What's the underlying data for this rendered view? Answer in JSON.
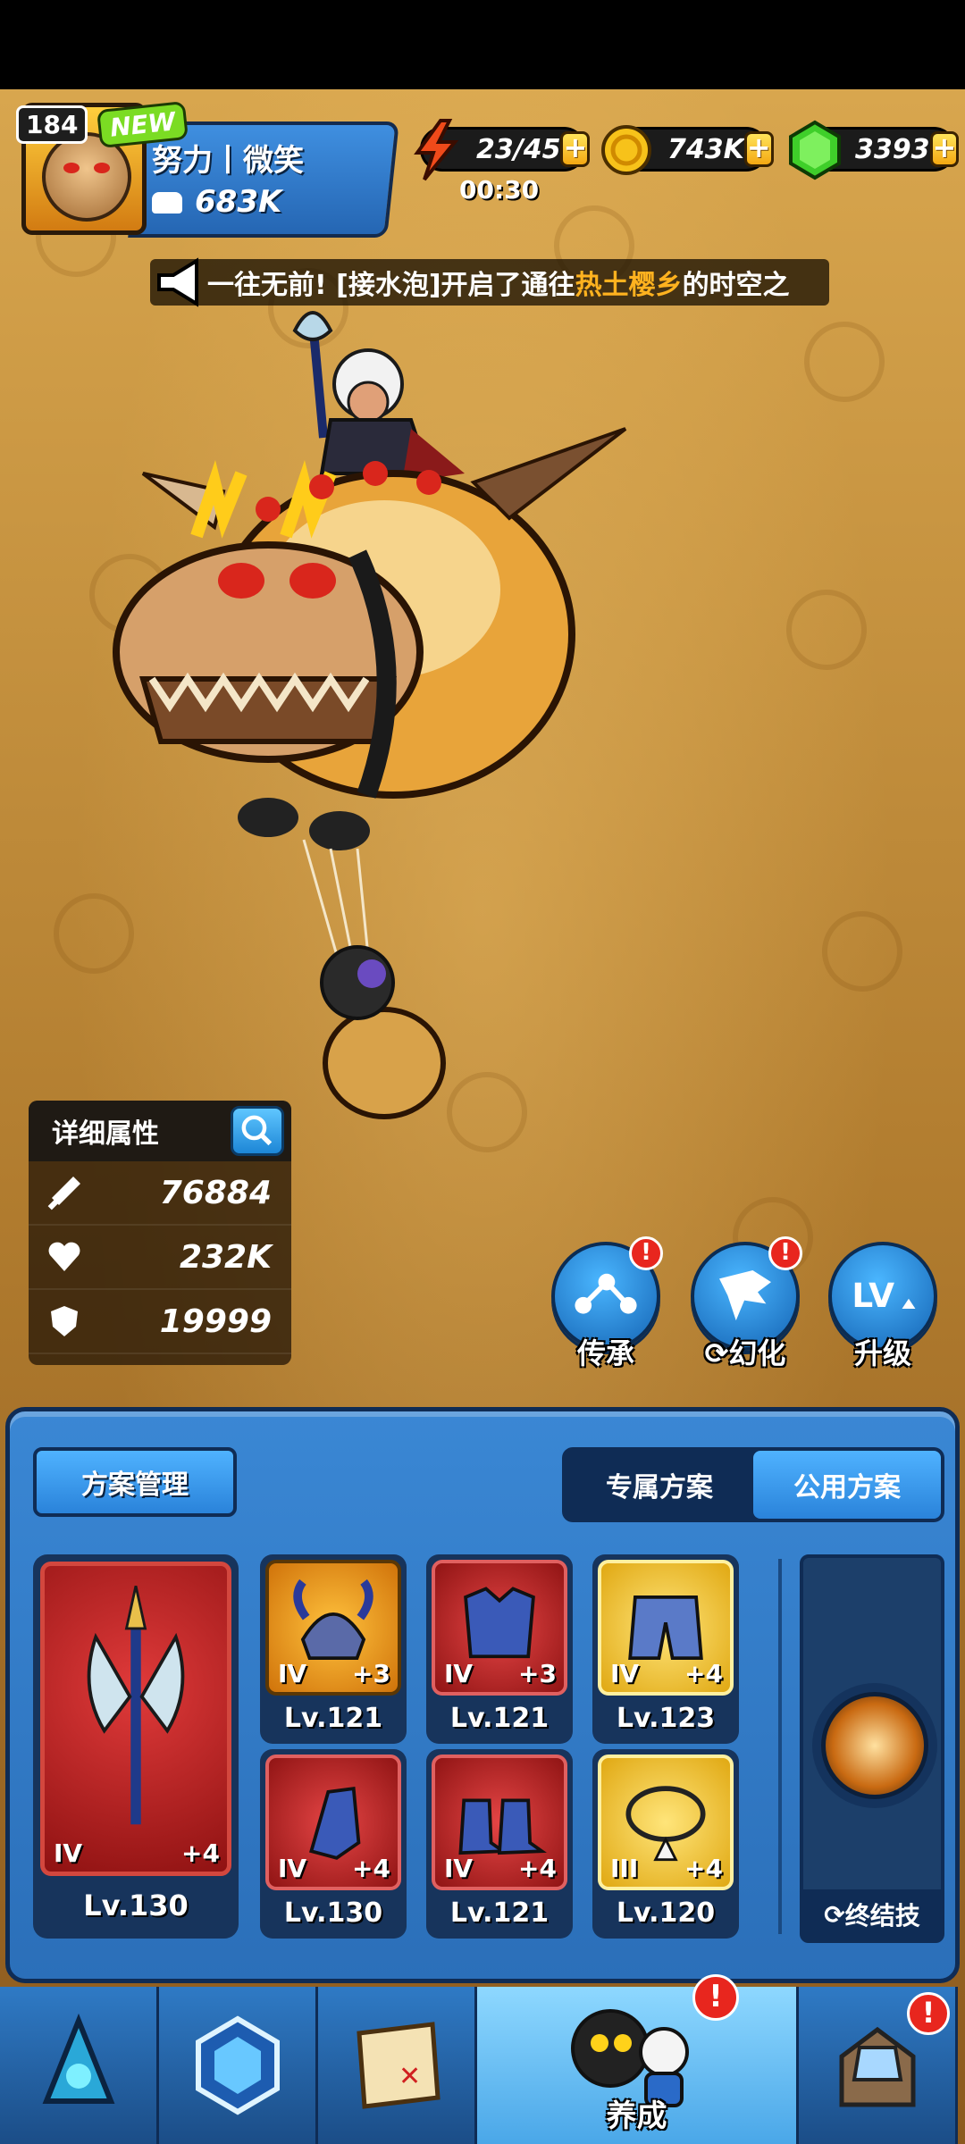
{
  "player": {
    "level": "184",
    "new_badge": "NEW",
    "name": "努力丨微笑",
    "power": "683K"
  },
  "resources": {
    "stamina": "23/45",
    "stamina_timer": "00:30",
    "gold": "743K",
    "gems": "3393",
    "plus": "+"
  },
  "announcement": {
    "prefix": "一往无前! [接水泡]开启了通往",
    "highlight": "热土樱乡",
    "suffix": "的时空之"
  },
  "stats": {
    "title": "详细属性",
    "attack": "76884",
    "hp": "232K",
    "defense": "19999"
  },
  "actions": [
    {
      "label": "传承",
      "badge": "!"
    },
    {
      "label": "幻化",
      "badge": "!"
    },
    {
      "label": "升级"
    }
  ],
  "equipment": {
    "plan_mgmt": "方案管理",
    "tabs": [
      "专属方案",
      "公用方案"
    ],
    "active_tab": "公用方案",
    "weapon": {
      "tier": "IV",
      "plus": "+4",
      "level": "Lv.130"
    },
    "slots": [
      {
        "tier": "IV",
        "plus": "+3",
        "level": "Lv.121",
        "rarity": "orange"
      },
      {
        "tier": "IV",
        "plus": "+3",
        "level": "Lv.121",
        "rarity": "red"
      },
      {
        "tier": "IV",
        "plus": "+4",
        "level": "Lv.123",
        "rarity": "gold"
      },
      {
        "tier": "IV",
        "plus": "+4",
        "level": "Lv.130",
        "rarity": "red"
      },
      {
        "tier": "IV",
        "plus": "+4",
        "level": "Lv.121",
        "rarity": "red"
      },
      {
        "tier": "III",
        "plus": "+4",
        "level": "Lv.120",
        "rarity": "gold"
      }
    ],
    "ultimate_label": "终结技"
  },
  "nav": {
    "active_label": "养成",
    "badge": "!"
  },
  "colors": {
    "panel_blue": "#2b6fb9",
    "highlight_orange": "#ffb21f",
    "badge_red": "#e8261e",
    "gem_green": "#3fcf2a",
    "gold_coin": "#f7c21a"
  }
}
